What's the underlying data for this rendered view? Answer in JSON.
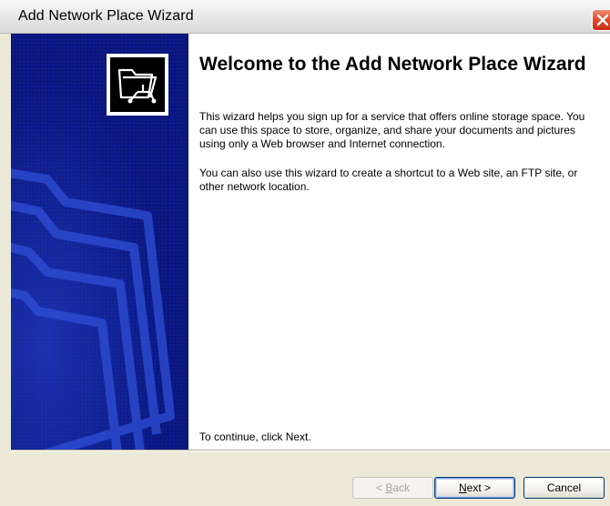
{
  "window": {
    "title": "Add Network Place Wizard"
  },
  "sidebar": {
    "icon": "network-folder-icon",
    "background_color": "#0c1a8e"
  },
  "content": {
    "heading": "Welcome to the Add Network Place Wizard",
    "paragraph1": "This wizard helps you sign up for a service that offers online storage space. You can use this space to store, organize, and share your documents and pictures using only a Web browser and Internet connection.",
    "paragraph2": "You can also use this wizard to create a shortcut to a Web site, an FTP site, or other network location.",
    "continue_text": "To continue, click Next."
  },
  "buttons": {
    "back": {
      "label_prefix": "< ",
      "mnemonic": "B",
      "label_rest": "ack"
    },
    "next": {
      "mnemonic": "N",
      "label_rest": "ext >"
    },
    "cancel": {
      "label": "Cancel"
    }
  }
}
